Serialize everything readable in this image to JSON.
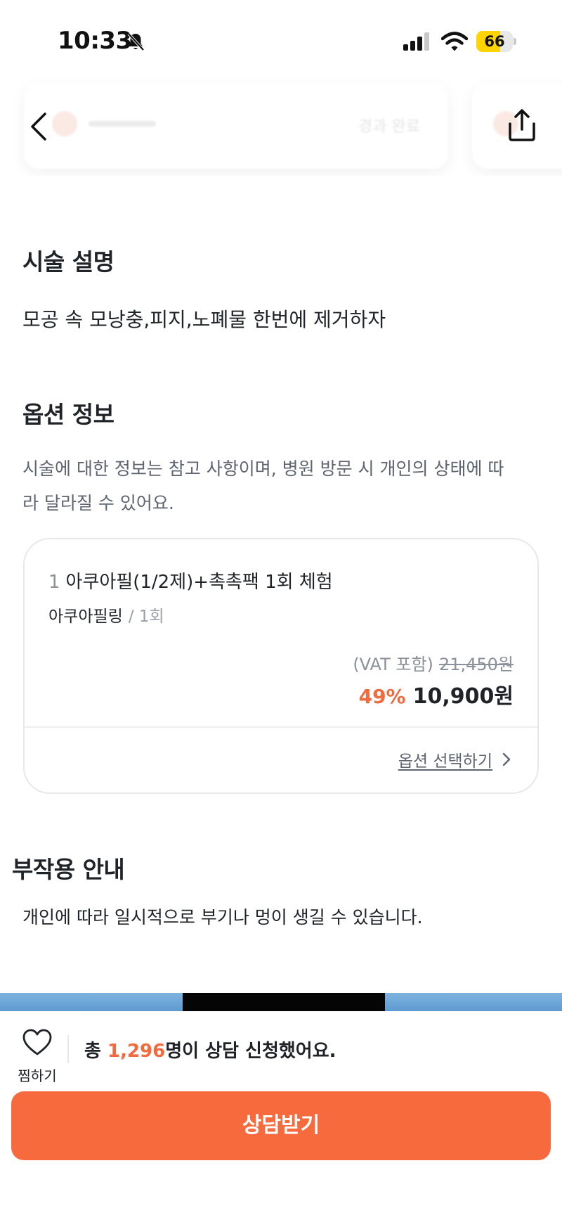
{
  "status_bar": {
    "time": "10:33",
    "battery": "66",
    "battery_fraction": 0.66,
    "icons": [
      "bell-off-icon",
      "cellular-signal-icon",
      "wifi-icon",
      "battery-icon"
    ]
  },
  "nav": {
    "back_icon": "chevron-left-icon",
    "share_icon": "share-upload-icon",
    "carousel_status": "경과 완료"
  },
  "description": {
    "title": "시술 설명",
    "text": "모공 속 모낭충,피지,노폐물 한번에 제거하자"
  },
  "options": {
    "title": "옵션 정보",
    "notice_line1": "시술에 대한 정보는 참고 사항이며, 병원 방문 시 개인의 상태에 따",
    "notice_line2": "라 달라질 수 있어요.",
    "items": [
      {
        "number": "1",
        "name": "아쿠아필(1/2제)+촉촉팩 1회 체험",
        "category": "아쿠아필링",
        "count": "/ 1회",
        "vat_label": "(VAT 포함)",
        "original_price": "21,450원",
        "discount": "49%",
        "price": "10,900원"
      }
    ],
    "select_label": "옵션 선택하기"
  },
  "side_effects": {
    "title": "부작용 안내",
    "text": "개인에 따라 일시적으로 부기나 멍이 생길 수 있습니다."
  },
  "bottom_bar": {
    "like_label": "찜하기",
    "consult_prefix": "총 ",
    "consult_count": "1,296",
    "consult_suffix": "명이 상담 신청했어요.",
    "cta_label": "상담받기"
  },
  "colors": {
    "accent": "#f66a3d",
    "text": "#1f2328",
    "muted": "#5f6570"
  }
}
